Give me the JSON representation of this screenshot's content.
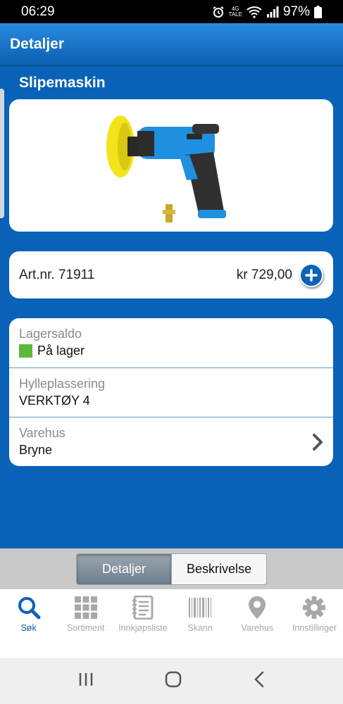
{
  "status_bar": {
    "time": "06:29",
    "network_top": "4G",
    "network_bottom": "TALE",
    "battery": "97%"
  },
  "header": {
    "title": "Detaljer"
  },
  "product": {
    "name": "Slipemaskin",
    "article_number": "Art.nr. 71911",
    "price": "kr 729,00"
  },
  "details": [
    {
      "label": "Lagersaldo",
      "value": "På lager",
      "stock_color": "#5db83c"
    },
    {
      "label": "Hylleplassering",
      "value": "VERKTØY 4"
    },
    {
      "label": "Varehus",
      "value": "Bryne"
    }
  ],
  "segment": {
    "active": "Detaljer",
    "inactive": "Beskrivelse"
  },
  "tabs": [
    {
      "label": "Søk",
      "icon": "search-icon",
      "active": true
    },
    {
      "label": "Sortiment",
      "icon": "grid-icon"
    },
    {
      "label": "Innkjøpsliste",
      "icon": "notebook-icon"
    },
    {
      "label": "Skann",
      "icon": "barcode-icon"
    },
    {
      "label": "Varehus",
      "icon": "location-pin-icon"
    },
    {
      "label": "Innstillinger",
      "icon": "gear-icon"
    }
  ],
  "colors": {
    "primary": "#0a62b8",
    "active_tab": "#0b62b8",
    "inactive_tab": "#a8a8a8"
  }
}
